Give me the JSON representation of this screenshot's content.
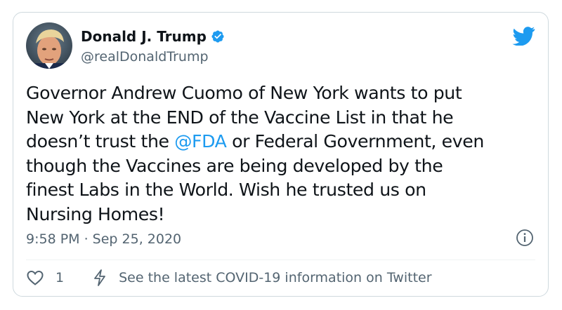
{
  "author": {
    "display_name": "Donald J. Trump",
    "handle": "@realDonaldTrump",
    "verified": true
  },
  "tweet": {
    "lines": [
      "Governor Andrew Cuomo of New York wants to put",
      "New York at the END of the Vaccine List in that he",
      [
        "doesn’t trust the ",
        "@FDA",
        " or Federal Government, even"
      ],
      "though the Vaccines are being developed by the",
      "finest Labs in the World. Wish he trusted us on",
      "Nursing Homes!"
    ],
    "timestamp": "9:58 PM · Sep 25, 2020"
  },
  "actions": {
    "like_count": "1",
    "covid_info_text": "See the latest COVID-19 information on Twitter"
  },
  "icons": {
    "logo": "twitter-bird-icon",
    "verified": "verified-badge-icon",
    "info": "info-icon",
    "like": "heart-icon",
    "covid": "bolt-icon"
  },
  "colors": {
    "text": "#0f1419",
    "secondary": "#536471",
    "accent": "#1d9bf0",
    "border": "#cfd9de"
  }
}
